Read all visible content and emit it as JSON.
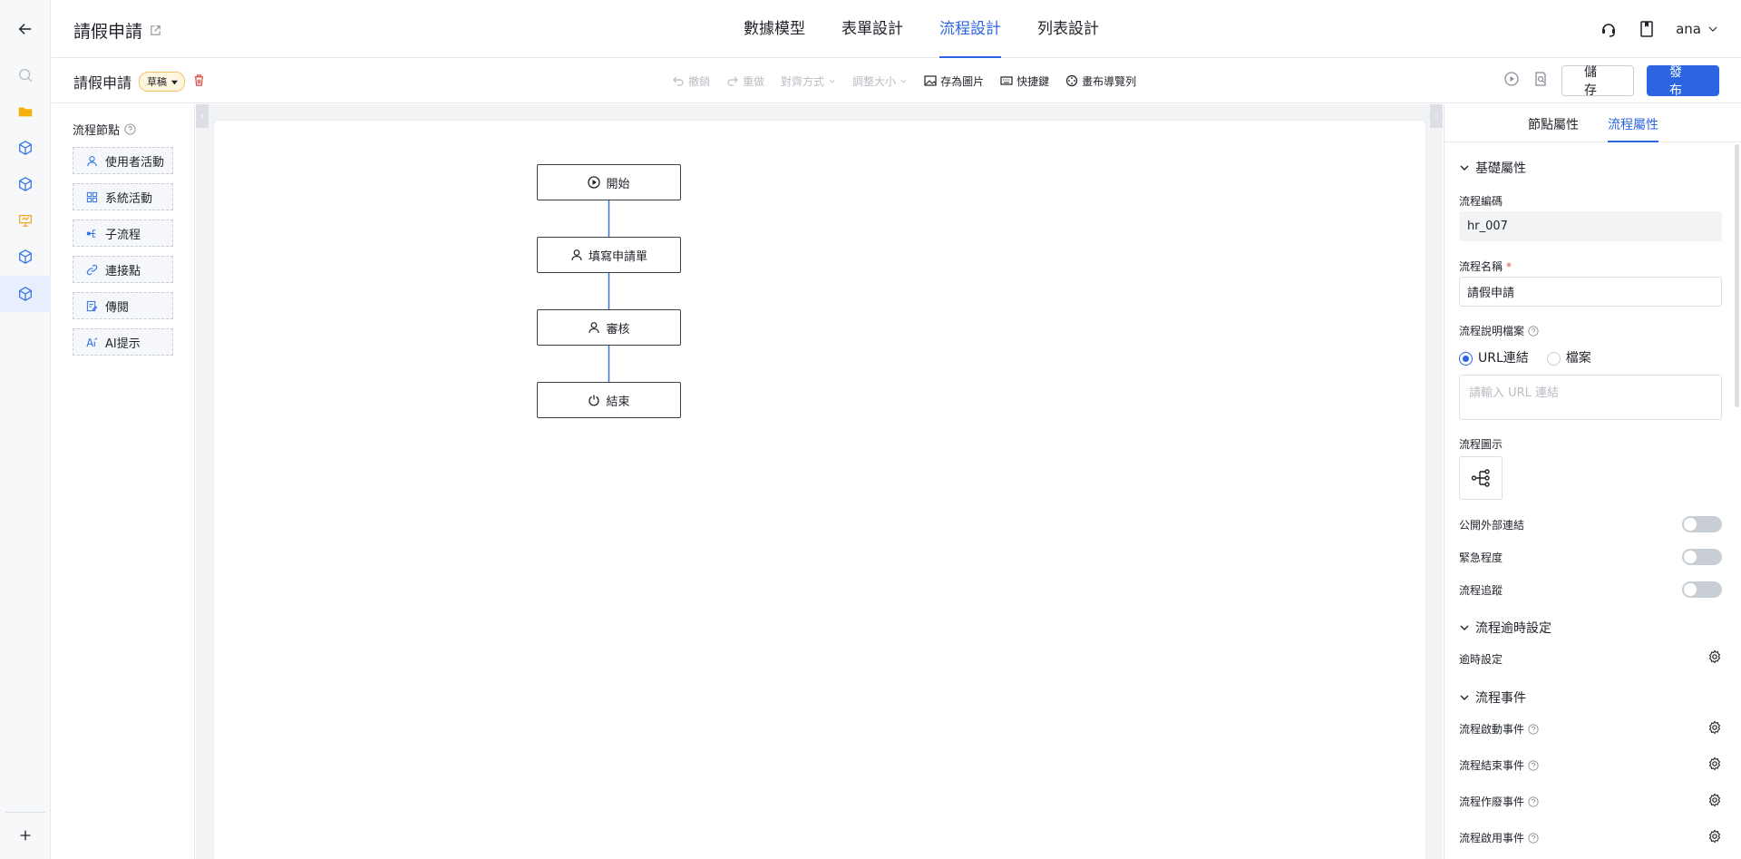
{
  "rail": {
    "icons": [
      "back-arrow-icon",
      "search-icon",
      "folder-icon",
      "cube-icon",
      "cube-icon",
      "presentation-icon",
      "cube-icon",
      "cube-icon",
      "plus-icon"
    ],
    "accent_colors": {
      "folder": "#f5b10a",
      "cube": "#3574e6",
      "presentation": "#f5a623"
    }
  },
  "header": {
    "title": "請假申請",
    "tabs": [
      {
        "label": "數據模型",
        "active": false
      },
      {
        "label": "表單設計",
        "active": false
      },
      {
        "label": "流程設計",
        "active": true
      },
      {
        "label": "列表設計",
        "active": false
      }
    ],
    "user": "ana"
  },
  "toolbar": {
    "title": "請假申請",
    "status": "草稿",
    "undo": "撤銷",
    "redo": "重做",
    "align": "對齊方式",
    "resize": "調整大小",
    "save_image": "存為圖片",
    "shortcuts": "快捷鍵",
    "navigator": "畫布導覽列",
    "save": "儲 存",
    "publish": "發 布"
  },
  "palette": {
    "title": "流程節點",
    "items": [
      {
        "label": "使用者活動",
        "icon": "user-icon"
      },
      {
        "label": "系統活動",
        "icon": "grid-icon"
      },
      {
        "label": "子流程",
        "icon": "subprocess-icon"
      },
      {
        "label": "連接點",
        "icon": "link-icon"
      },
      {
        "label": "傳閱",
        "icon": "circulate-icon"
      },
      {
        "label": "AI提示",
        "icon": "ai-icon"
      }
    ]
  },
  "flow": {
    "nodes": [
      {
        "label": "開始",
        "icon": "play-circle-icon"
      },
      {
        "label": "填寫申請單",
        "icon": "user-icon"
      },
      {
        "label": "審核",
        "icon": "user-icon"
      },
      {
        "label": "結束",
        "icon": "power-icon"
      }
    ],
    "connector_color": "#3574e6"
  },
  "props": {
    "tabs": [
      {
        "label": "節點屬性",
        "active": false
      },
      {
        "label": "流程屬性",
        "active": true
      }
    ],
    "basic_section": "基礎屬性",
    "code_label": "流程編碼",
    "code_value": "hr_007",
    "name_label": "流程名稱",
    "name_required": "*",
    "name_value": "請假申請",
    "doc_label": "流程說明檔案",
    "doc_options": [
      {
        "label": "URL連結",
        "selected": true
      },
      {
        "label": "檔案",
        "selected": false
      }
    ],
    "doc_placeholder": "請輸入 URL 連結",
    "icon_label": "流程圖示",
    "toggles": [
      {
        "label": "公開外部連結",
        "on": false
      },
      {
        "label": "緊急程度",
        "on": false
      },
      {
        "label": "流程追蹤",
        "on": false
      }
    ],
    "timeout_section": "流程逾時設定",
    "timeout_label": "逾時設定",
    "events_section": "流程事件",
    "events": [
      "流程啟動事件",
      "流程結束事件",
      "流程作廢事件",
      "流程啟用事件"
    ]
  }
}
